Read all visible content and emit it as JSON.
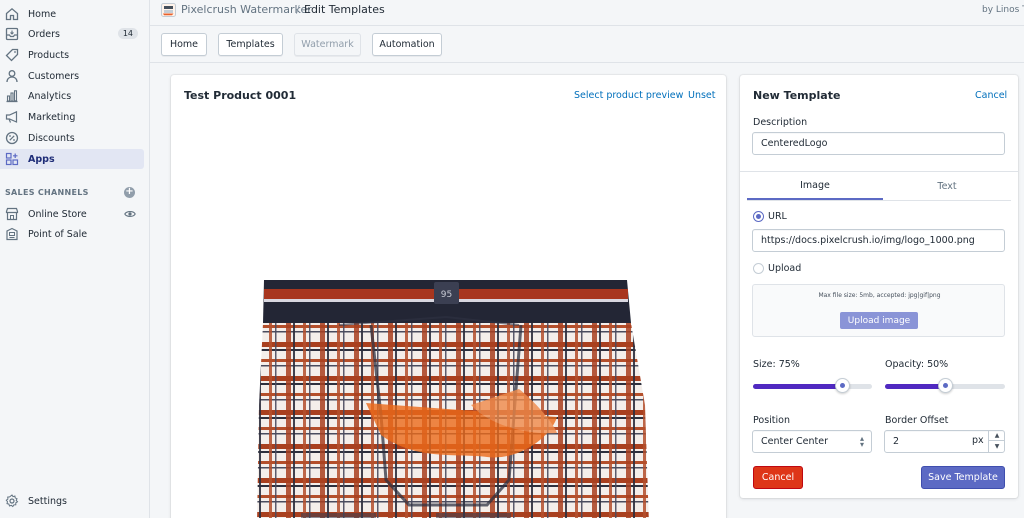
{
  "sidebar": {
    "items": [
      {
        "label": "Home",
        "icon": "home-icon"
      },
      {
        "label": "Orders",
        "icon": "orders-icon",
        "badge": "14"
      },
      {
        "label": "Products",
        "icon": "tag-icon"
      },
      {
        "label": "Customers",
        "icon": "person-icon"
      },
      {
        "label": "Analytics",
        "icon": "bar-chart-icon"
      },
      {
        "label": "Marketing",
        "icon": "megaphone-icon"
      },
      {
        "label": "Discounts",
        "icon": "discount-icon"
      },
      {
        "label": "Apps",
        "icon": "apps-icon",
        "active": true
      }
    ],
    "sales_channels_heading": "SALES CHANNELS",
    "channels": [
      {
        "label": "Online Store",
        "icon": "store-icon"
      },
      {
        "label": "Point of Sale",
        "icon": "pos-icon"
      }
    ],
    "settings_label": "Settings"
  },
  "header": {
    "app_name": "Pixelcrush Watermarker",
    "separator": "/",
    "page_title": "Edit Templates",
    "byline": "by Linos T"
  },
  "tabs": [
    {
      "label": "Home"
    },
    {
      "label": "Templates"
    },
    {
      "label": "Watermark",
      "disabled": true
    },
    {
      "label": "Automation"
    }
  ],
  "preview": {
    "title": "Test Product 0001",
    "select_link": "Select product preview",
    "unset_link": "Unset"
  },
  "template_form": {
    "title": "New Template",
    "cancel_link": "Cancel",
    "description_label": "Description",
    "description_value": "CenteredLogo",
    "tabs": [
      {
        "label": "Image",
        "active": true
      },
      {
        "label": "Text"
      }
    ],
    "url_label": "URL",
    "url_value": "https://docs.pixelcrush.io/img/logo_1000.png",
    "upload_label": "Upload",
    "upload_note": "Max file size: 5mb, accepted: jpg|gif|png",
    "upload_button": "Upload image",
    "size_label": "Size: 75%",
    "size_value": 0.75,
    "opacity_label": "Opacity: 50%",
    "opacity_value": 0.5,
    "position_label": "Position",
    "position_value": "Center Center",
    "border_label": "Border Offset",
    "border_value": "2",
    "border_unit": "px",
    "cancel_button": "Cancel",
    "save_button": "Save Template"
  },
  "colors": {
    "accent": "#5c6ac4",
    "slider_fill": "#5029c1",
    "link": "#006fbb",
    "danger": "#de3618",
    "upload_button": "#8a94d7"
  }
}
